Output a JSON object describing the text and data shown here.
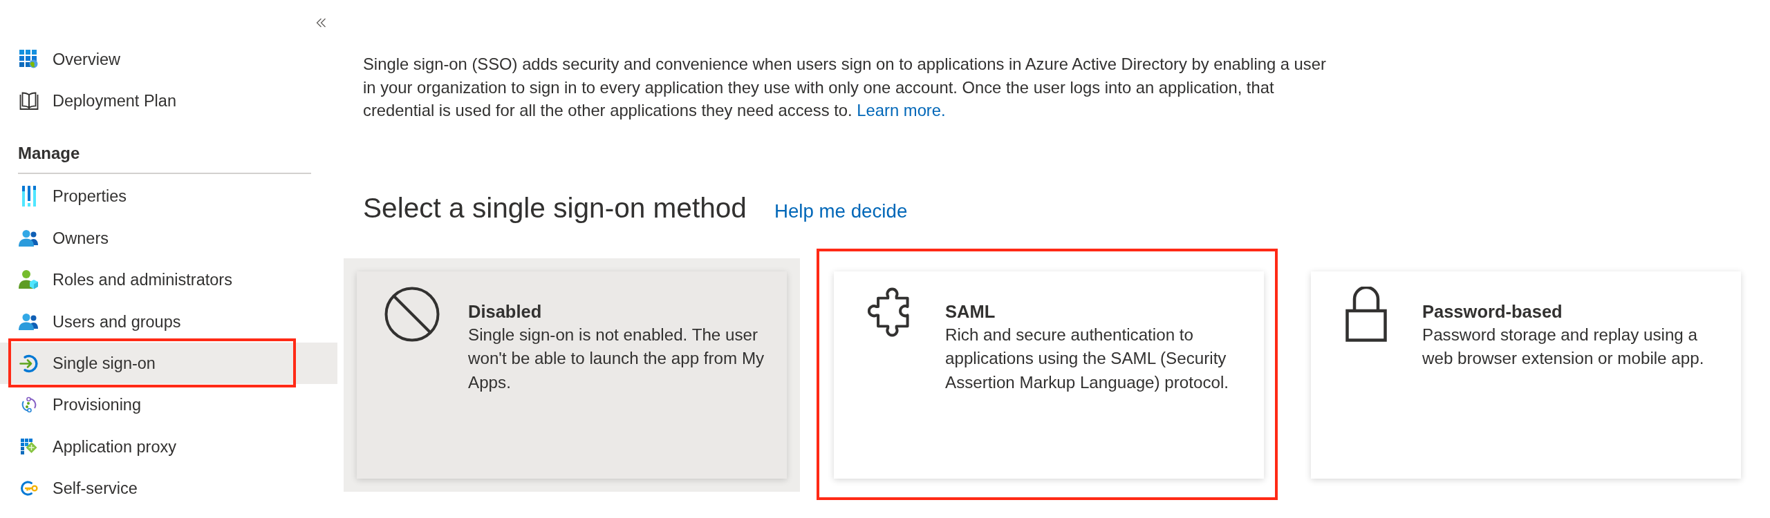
{
  "sidebar": {
    "items": [
      {
        "label": "Overview",
        "selected": false,
        "annotated": false
      },
      {
        "label": "Deployment Plan",
        "selected": false,
        "annotated": false
      }
    ],
    "sections": [
      {
        "title": "Manage",
        "items": [
          {
            "label": "Properties",
            "selected": false,
            "annotated": false
          },
          {
            "label": "Owners",
            "selected": false,
            "annotated": false
          },
          {
            "label": "Roles and administrators",
            "selected": false,
            "annotated": false
          },
          {
            "label": "Users and groups",
            "selected": false,
            "annotated": false
          },
          {
            "label": "Single sign-on",
            "selected": true,
            "annotated": true
          },
          {
            "label": "Provisioning",
            "selected": false,
            "annotated": false
          },
          {
            "label": "Application proxy",
            "selected": false,
            "annotated": false
          },
          {
            "label": "Self-service",
            "selected": false,
            "annotated": false
          }
        ]
      }
    ]
  },
  "content": {
    "intro": {
      "text": "Single sign-on (SSO) adds security and convenience when users sign on to applications in Azure Active Directory by enabling a user in your organization to sign in to every application they use with only one account. Once the user logs into an application, that credential is used for all the other applications they need access to.",
      "link": "Learn more."
    },
    "heading": "Select a single sign-on method",
    "help_link": "Help me decide",
    "methods": [
      {
        "title": "Disabled",
        "description": "Single sign-on is not enabled. The user won't be able to launch the app from My Apps.",
        "selected": true,
        "annotated": false
      },
      {
        "title": "SAML",
        "description": "Rich and secure authentication to applications using the SAML (Security Assertion Markup Language) protocol.",
        "selected": false,
        "annotated": true
      },
      {
        "title": "Password-based",
        "description": "Password storage and replay using a web browser extension or mobile app.",
        "selected": false,
        "annotated": false
      }
    ]
  }
}
